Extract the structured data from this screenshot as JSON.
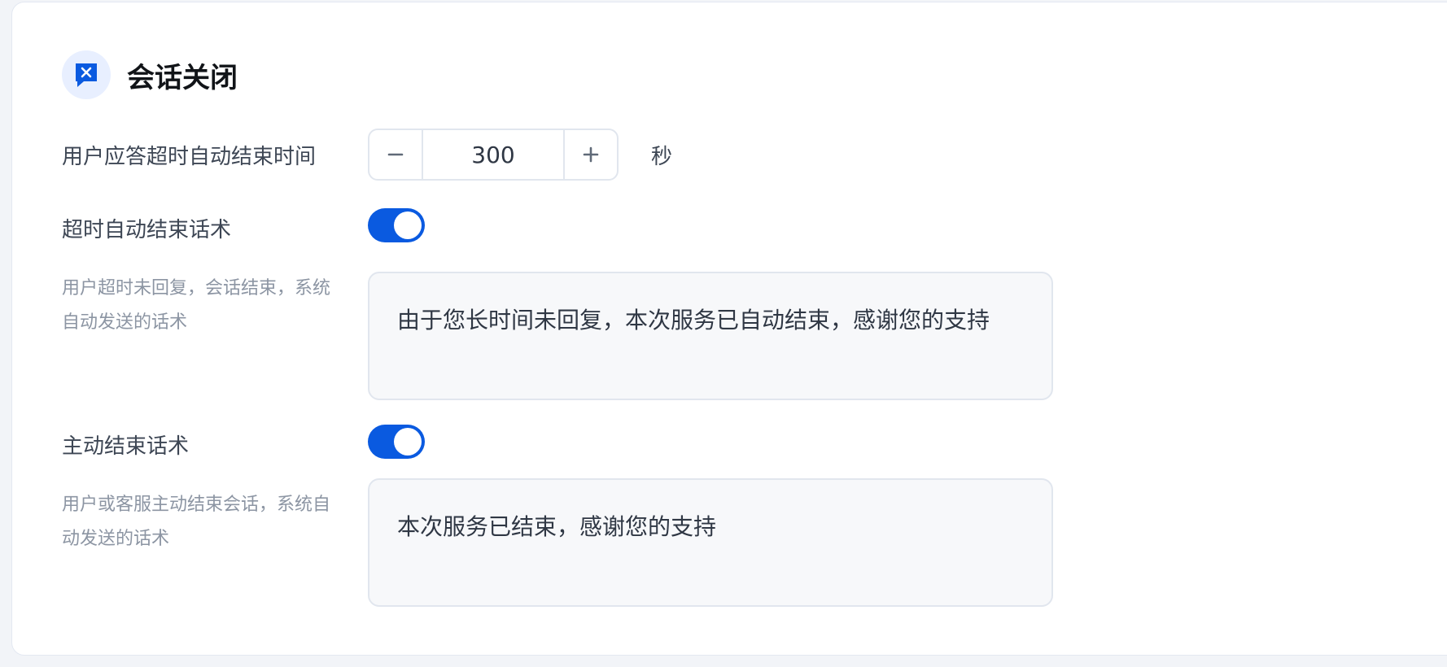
{
  "section": {
    "title": "会话关闭",
    "icon": "chat-close-icon",
    "accent_color": "#0a5ae0"
  },
  "timeout": {
    "label": "用户应答超时自动结束时间",
    "value": "300",
    "unit": "秒",
    "decrement_icon": "minus-icon",
    "increment_icon": "plus-icon"
  },
  "timeout_message": {
    "label": "超时自动结束话术",
    "enabled": true,
    "description": "用户超时未回复，会话结束，系统自动发送的话术",
    "text": "由于您长时间未回复，本次服务已自动结束，感谢您的支持"
  },
  "manual_message": {
    "label": "主动结束话术",
    "enabled": true,
    "description": "用户或客服主动结束会话，系统自动发送的话术",
    "text": "本次服务已结束，感谢您的支持"
  }
}
